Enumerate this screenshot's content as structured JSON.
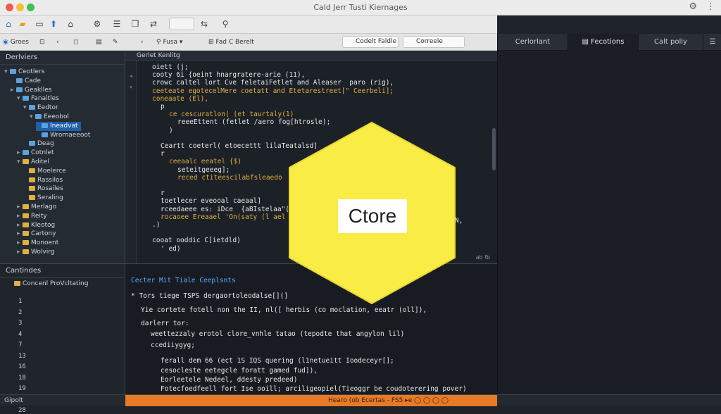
{
  "window": {
    "title": "Cald Jerr Tusti Kiernages"
  },
  "toolbar2": {
    "item1": "Groes",
    "item2": "Fusa",
    "item3": "Fad C Berelt",
    "field1": "Codelt Faldle",
    "field2": "Correele"
  },
  "sidebar": {
    "header": "Derlviers",
    "items": [
      {
        "label": "Ceotlers",
        "indent": 0,
        "color": "blue",
        "caret": "▾"
      },
      {
        "label": "Cade",
        "indent": 1,
        "color": "blue",
        "caret": ""
      },
      {
        "label": "Geaklles",
        "indent": 1,
        "color": "blue",
        "caret": "▸"
      },
      {
        "label": "Fanaitles",
        "indent": 2,
        "color": "blue",
        "caret": "▾"
      },
      {
        "label": "Eedtor",
        "indent": 3,
        "color": "blue",
        "caret": "▾"
      },
      {
        "label": "Eeeobol",
        "indent": 4,
        "color": "blue",
        "caret": "▾"
      },
      {
        "label": "Ineadvat",
        "indent": 5,
        "color": "blue",
        "caret": "",
        "selected": true
      },
      {
        "label": "Wromaeeoot",
        "indent": 5,
        "color": "blue",
        "caret": ""
      },
      {
        "label": "Deag",
        "indent": 3,
        "color": "blue",
        "caret": ""
      },
      {
        "label": "Cotnlet",
        "indent": 2,
        "color": "blue",
        "caret": "▸"
      },
      {
        "label": "Aditel",
        "indent": 2,
        "color": "yellow",
        "caret": "▾"
      },
      {
        "label": "Moelerce",
        "indent": 3,
        "color": "yellow",
        "caret": ""
      },
      {
        "label": "Rassilos",
        "indent": 3,
        "color": "yellow",
        "caret": ""
      },
      {
        "label": "Rosailes",
        "indent": 3,
        "color": "yellow",
        "caret": ""
      },
      {
        "label": "Seraling",
        "indent": 3,
        "color": "yellow",
        "caret": ""
      },
      {
        "label": "Merlago",
        "indent": 2,
        "color": "yellow",
        "caret": "▸"
      },
      {
        "label": "Reity",
        "indent": 2,
        "color": "yellow",
        "caret": "▸"
      },
      {
        "label": "Kleotog",
        "indent": 2,
        "color": "yellow",
        "caret": "▸"
      },
      {
        "label": "Cartony",
        "indent": 2,
        "color": "yellow",
        "caret": "▸"
      },
      {
        "label": "Monoent",
        "indent": 2,
        "color": "yellow",
        "caret": "▸"
      },
      {
        "label": "Wolvirg",
        "indent": 2,
        "color": "yellow",
        "caret": "▸"
      }
    ]
  },
  "editor": {
    "tab": "Gerlet Kenlitg",
    "lines": [
      {
        "text": "oiett (j;",
        "indent": 0,
        "color": "#e8e8e8"
      },
      {
        "text": "cooty 6i {oeint hnargratere-arie (11),",
        "indent": 0,
        "color": "#e8e8e8"
      },
      {
        "text": "crowc caltel lort Cve feletaiFetlet and Aleaser  paro (rig),",
        "indent": 0,
        "color": "#e8e8e8"
      },
      {
        "text": "ceeteate egotecelMere coetatt and Etetarestreet[\" Ceerbeli];",
        "indent": 0,
        "color": "#e0b040"
      },
      {
        "text": "coneaate (El),",
        "indent": 0,
        "color": "#e0b040"
      },
      {
        "text": "p",
        "indent": 1,
        "color": "#e8e8e8"
      },
      {
        "text": "ce cescuratlon( (et taurtaly(1)",
        "indent": 2,
        "color": "#e0b040"
      },
      {
        "text": "reeeEttent (fetlet /aero fog[htrosle);",
        "indent": 3,
        "color": "#e8e8e8"
      },
      {
        "text": ")",
        "indent": 2,
        "color": "#e8e8e8"
      },
      {
        "text": "",
        "indent": 0,
        "color": "#e8e8e8"
      },
      {
        "text": "Ceartt coeterl( etoecettt lilaTeatalsd]",
        "indent": 1,
        "color": "#e8e8e8"
      },
      {
        "text": "r",
        "indent": 1,
        "color": "#e8e8e8"
      },
      {
        "text": "ceeaalc eeatel {$)",
        "indent": 2,
        "color": "#e0b040"
      },
      {
        "text": "seteitgeeeg];",
        "indent": 3,
        "color": "#e8e8e8"
      },
      {
        "text": "reced ctiteescilabfsleaedo",
        "indent": 3,
        "color": "#e0b040"
      },
      {
        "text": "",
        "indent": 0,
        "color": "#e8e8e8"
      },
      {
        "text": "r",
        "indent": 1,
        "color": "#e8e8e8"
      },
      {
        "text": "toetlecer eveooal caeaal]",
        "indent": 1,
        "color": "#e8e8e8"
      },
      {
        "text": "rceedaeee es: iDce  {aBIstelaa\"(isa",
        "indent": 1,
        "color": "#e8e8e8"
      },
      {
        "text": "rocaoee Ereaael 'On(saty (l ael",
        "indent": 1,
        "color": "#e0b040"
      },
      {
        "text": ".)",
        "indent": 0,
        "color": "#e8e8e8"
      },
      {
        "text": "",
        "indent": 0,
        "color": "#e8e8e8"
      },
      {
        "text": "cooat ooddic C[ietdld)",
        "indent": 0,
        "color": "#e8e8e8"
      },
      {
        "text": "' ed)",
        "indent": 1,
        "color": "#e8e8e8"
      }
    ],
    "line_tail": "N,",
    "status": "ab fb"
  },
  "bottom": {
    "sidebar_header": "Cantindes",
    "sidebar_item": "Concenl ProVcltating",
    "line_numbers": [
      "1",
      "2",
      "3",
      "4",
      "7",
      "13",
      "16",
      "18",
      "19",
      "25",
      "28"
    ],
    "header": "Cecter Mit Tiale Ceeplsnts",
    "lines": [
      {
        "text": "* Tors tiege TSPS dergaortoleodalse[](]",
        "color": "#e8e8e8",
        "indent": 0
      },
      {
        "text": "Yie cortete fotell non the II, nl([ herbis (co moclation, eeatr (oll]),",
        "color": "#e8e8e8",
        "indent": 1
      },
      {
        "text": "darlerr tor:",
        "color": "#e8e8e8",
        "indent": 1
      },
      {
        "text": "weettezzaly erotol clore_vnhle tatao (tepodte that angylon lil)",
        "color": "#e8e8e8",
        "indent": 2
      },
      {
        "text": "ccediiygyg;",
        "color": "#e8e8e8",
        "indent": 2
      },
      {
        "text": "ferall dem 66 (ect 1S IQS quering (l1netueitt Ioodeceyr[];",
        "color": "#e8e8e8",
        "indent": 3
      },
      {
        "text": "cesocleste eetegcle foratt gamed fud]),",
        "color": "#e8e8e8",
        "indent": 3
      },
      {
        "text": "Eorleetele Nedeel, ddesty predeed)",
        "color": "#e8e8e8",
        "indent": 3
      },
      {
        "text": "Fotecfoedfeell fort Ise ooill; arciligeopiel(Tieoggr be coudoterering pover)",
        "color": "#e8e8e8",
        "indent": 3
      }
    ]
  },
  "right_panel": {
    "tabs": [
      "Cerlorlant",
      "Fecotions",
      "Calt poliy"
    ]
  },
  "statusbar": {
    "left": "Gipolt",
    "center": "Hearo (ob Ecertas - FS5 ▸e ◯ ◯ ◯ ◯"
  },
  "overlay": {
    "label": "Ctore",
    "color": "#f9ec45"
  }
}
